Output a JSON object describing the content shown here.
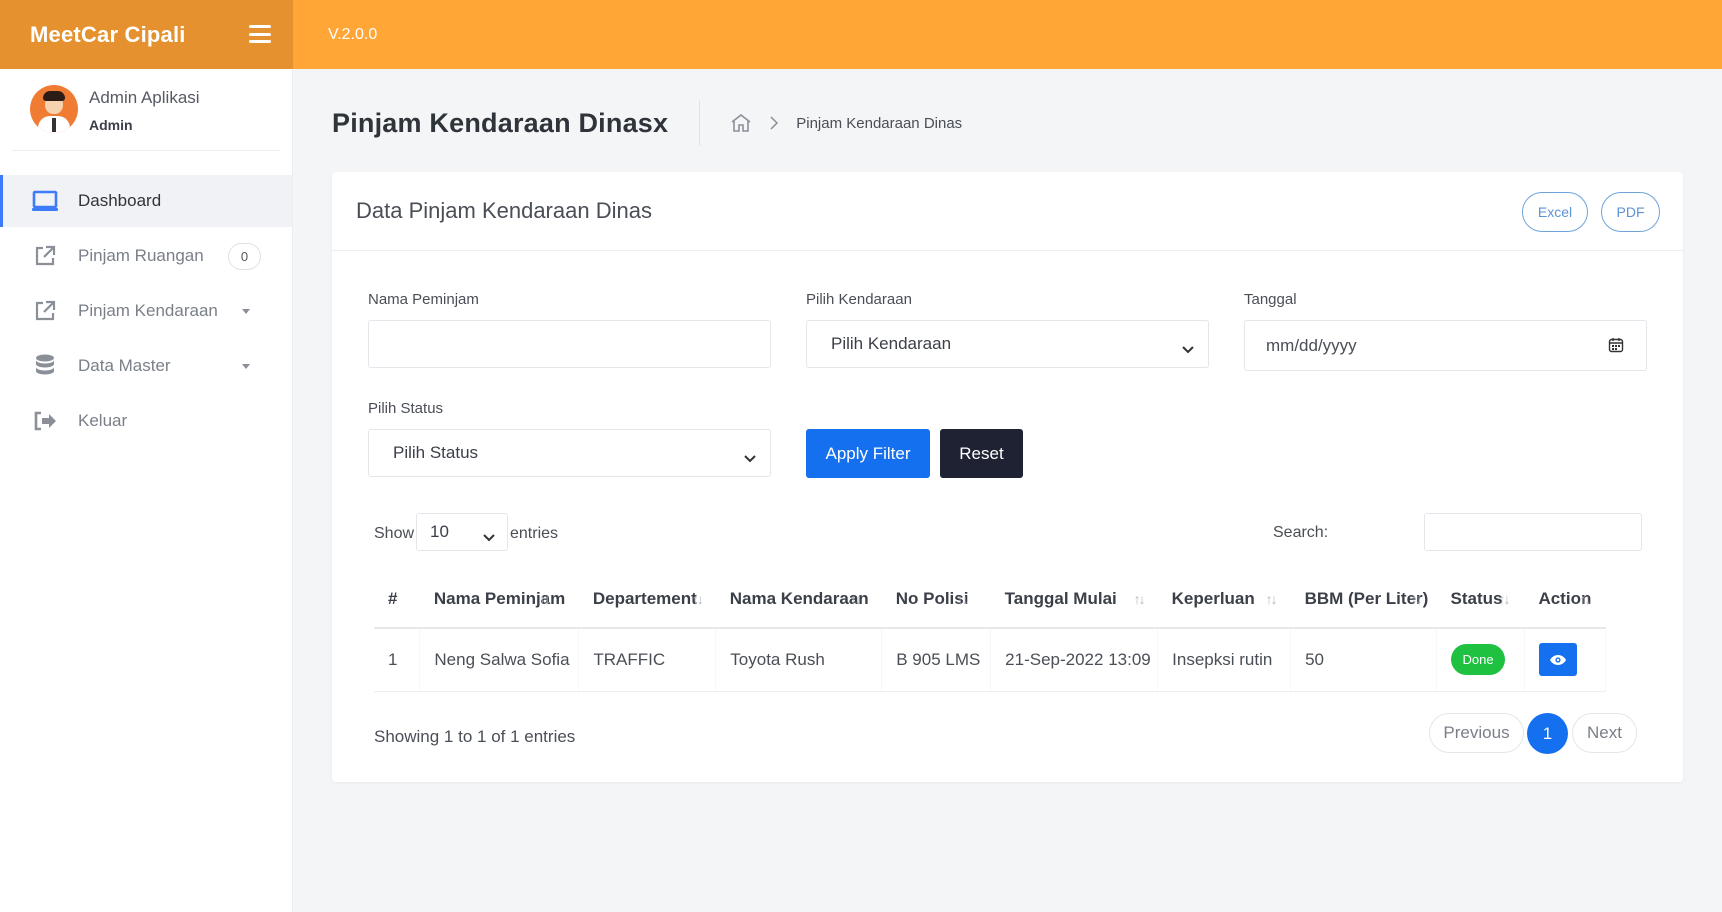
{
  "app": {
    "name": "MeetCar Cipali",
    "version": "V.2.0.0"
  },
  "user": {
    "name": "Admin Aplikasi",
    "role": "Admin"
  },
  "sidebar": {
    "items": [
      {
        "label": "Dashboard",
        "icon": "monitor-icon",
        "active": true
      },
      {
        "label": "Pinjam Ruangan",
        "icon": "external-link-icon",
        "badge": "0"
      },
      {
        "label": "Pinjam Kendaraan",
        "icon": "external-link-icon",
        "has_submenu": true
      },
      {
        "label": "Data Master",
        "icon": "database-icon",
        "has_submenu": true
      },
      {
        "label": "Keluar",
        "icon": "sign-out-icon"
      }
    ]
  },
  "page": {
    "title": "Pinjam Kendaraan Dinasx",
    "breadcrumb": {
      "current": "Pinjam Kendaraan Dinas"
    }
  },
  "card": {
    "title": "Data Pinjam Kendaraan Dinas",
    "export": {
      "excel": "Excel",
      "pdf": "PDF"
    }
  },
  "filters": {
    "nama_label": "Nama Peminjam",
    "nama_value": "",
    "kendaraan_label": "Pilih Kendaraan",
    "kendaraan_value": "Pilih Kendaraan",
    "tanggal_label": "Tanggal",
    "tanggal_value": "mm/dd/yyyy",
    "status_label": "Pilih Status",
    "status_value": "Pilih Status",
    "apply": "Apply Filter",
    "reset": "Reset"
  },
  "datatable": {
    "show_label": "Show",
    "length_value": "10",
    "entries_label": "entries",
    "search_label": "Search:",
    "columns": [
      "#",
      "Nama Peminjam",
      "Departement",
      "Nama Kendaraan",
      "No Polisi",
      "Tanggal Mulai",
      "Keperluan",
      "BBM (Per Liter)",
      "Status",
      "Action"
    ],
    "rows": [
      {
        "no": "1",
        "nama": "Neng Salwa Sofia",
        "departement": "TRAFFIC",
        "kendaraan": "Toyota Rush",
        "polisi": "B 905 LMS",
        "tanggal": "21-Sep-2022 13:09",
        "keperluan": "Insepksi rutin",
        "bbm": "50",
        "status": "Done",
        "action_icon": "eye-icon"
      }
    ],
    "info": "Showing 1 to 1 of 1 entries",
    "pagination": {
      "previous": "Previous",
      "current": "1",
      "next": "Next"
    }
  },
  "colors": {
    "brand": "#e6912f",
    "topbar": "#ffa636",
    "primary": "#1570ef",
    "success": "#1fc140",
    "dark": "#1f2233"
  }
}
